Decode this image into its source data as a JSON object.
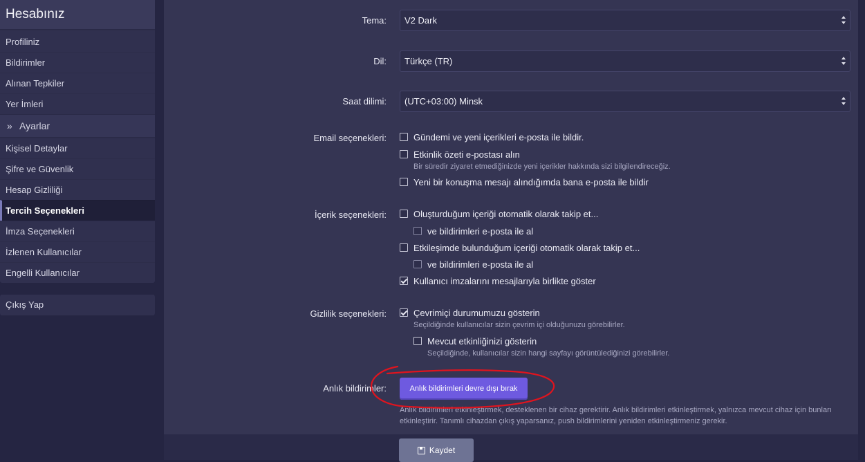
{
  "sidebar": {
    "title": "Hesabınız",
    "account_items": [
      "Profiliniz",
      "Bildirimler",
      "Alınan Tepkiler",
      "Yer İmleri"
    ],
    "section_label": "Ayarlar",
    "settings_items": [
      "Kişisel Detaylar",
      "Şifre ve Güvenlik",
      "Hesap Gizliliği",
      "Tercih Seçenekleri",
      "İmza Seçenekleri",
      "İzlenen Kullanıcılar",
      "Engelli Kullanıcılar"
    ],
    "active_item": "Tercih Seçenekleri",
    "logout": "Çıkış Yap"
  },
  "form": {
    "theme": {
      "label": "Tema:",
      "value": "V2 Dark"
    },
    "language": {
      "label": "Dil:",
      "value": "Türkçe (TR)"
    },
    "timezone": {
      "label": "Saat dilimi:",
      "value": "(UTC+03:00) Minsk"
    },
    "email": {
      "label": "Email seçenekleri:",
      "opt1": "Gündemi ve yeni içerikleri e-posta ile bildir.",
      "opt2": "Etkinlik özeti e-postası alın",
      "opt2_hint": "Bir süredir ziyaret etmediğinizde yeni içerikler hakkında sizi bilgilendireceğiz.",
      "opt3": "Yeni bir konuşma mesajı alındığımda bana e-posta ile bildir"
    },
    "content": {
      "label": "İçerik seçenekleri:",
      "opt1": "Oluşturduğum içeriği otomatik olarak takip et...",
      "opt1_sub": "ve bildirimleri e-posta ile al",
      "opt2": "Etkileşimde bulunduğum içeriği otomatik olarak takip et...",
      "opt2_sub": "ve bildirimleri e-posta ile al",
      "opt3": "Kullanıcı imzalarını mesajlarıyla birlikte göster"
    },
    "privacy": {
      "label": "Gizlilik seçenekleri:",
      "opt1": "Çevrimiçi durumumuzu gösterin",
      "opt1_hint": "Seçildiğinde kullanıcılar sizin çevrim içi olduğunuzu görebilirler.",
      "opt2": "Mevcut etkinliğinizi gösterin",
      "opt2_hint": "Seçildiğinde, kullanıcılar sizin hangi sayfayı görüntülediğinizi görebilirler."
    },
    "push": {
      "label": "Anlık bildirimler:",
      "button": "Anlık bildirimleri devre dışı bırak",
      "desc": "Anlık bildirimleri etkinleştirmek, desteklenen bir cihaz gerektirir. Anlık bildirimleri etkinleştirmek, yalnızca mevcut cihaz için bunları etkinleştirir. Tanımlı cihazdan çıkış yaparsanız, push bildirimlerini yeniden etkinleştirmeniz gerekir."
    },
    "save": "Kaydet"
  },
  "colors": {
    "accent": "#6e5ae0",
    "annotation": "#e0141e"
  }
}
